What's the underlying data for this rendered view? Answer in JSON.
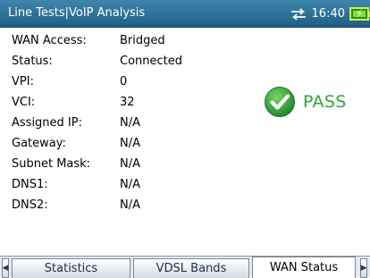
{
  "header": {
    "title": "Line Tests|VoIP Analysis",
    "time": "16:40",
    "network_icon": "network-transfer-icon",
    "battery_icon": "battery-charging-icon"
  },
  "wan_status": [
    {
      "label": "WAN Access:",
      "value": "Bridged"
    },
    {
      "label": "Status:",
      "value": "Connected"
    },
    {
      "label": "VPI:",
      "value": "0"
    },
    {
      "label": "VCI:",
      "value": "32"
    },
    {
      "label": "Assigned IP:",
      "value": "N/A"
    },
    {
      "label": "Gateway:",
      "value": "N/A"
    },
    {
      "label": "Subnet Mask:",
      "value": "N/A"
    },
    {
      "label": "DNS1:",
      "value": "N/A"
    },
    {
      "label": "DNS2:",
      "value": "N/A"
    }
  ],
  "result": {
    "text": "PASS",
    "icon": "checkmark-circle-icon",
    "color": "#2fa83a"
  },
  "tabs": [
    {
      "label": "Statistics",
      "active": false
    },
    {
      "label": "VDSL Bands",
      "active": false
    },
    {
      "label": "WAN Status",
      "active": true
    }
  ],
  "colors": {
    "titlebar": "#2a6f98",
    "pass_green": "#2fa83a"
  }
}
